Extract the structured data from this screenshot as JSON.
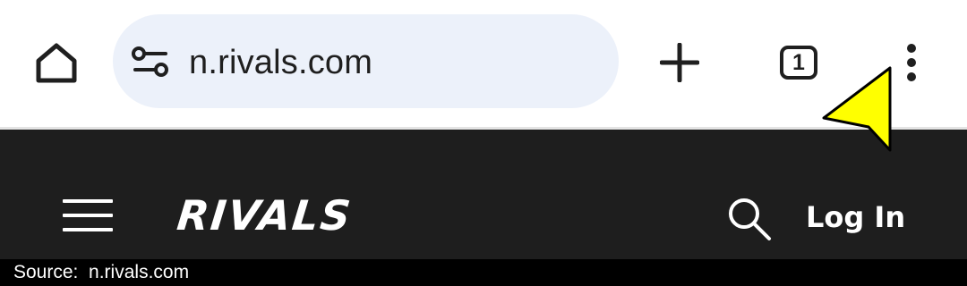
{
  "browser": {
    "url": "n.rivals.com",
    "tab_count": "1",
    "icons": {
      "home": "home-icon",
      "site_info": "tune-icon",
      "new_tab": "plus-icon",
      "tabs": "tab-switcher-icon",
      "menu": "more-vert-icon"
    },
    "omnibox_color": "#ecf1fa"
  },
  "site_header": {
    "logo_text": "RIVALS",
    "login_label": "Log In",
    "icons": {
      "menu": "hamburger-icon",
      "search": "search-icon"
    },
    "background_color": "#1e1e1e"
  },
  "pointer": {
    "icon": "yellow-arrow-cursor-icon",
    "color": "#ffff00"
  },
  "source": {
    "label": "Source:",
    "value": "n.rivals.com"
  }
}
